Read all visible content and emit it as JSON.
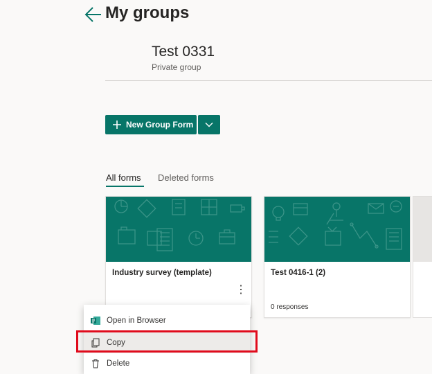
{
  "header": {
    "title": "My groups"
  },
  "group": {
    "name": "Test 0331",
    "type": "Private group"
  },
  "actions": {
    "new_group_form_label": "New Group Form"
  },
  "tabs": [
    {
      "label": "All forms",
      "selected": true
    },
    {
      "label": "Deleted forms",
      "selected": false
    }
  ],
  "cards": [
    {
      "title": "Industry survey (template)",
      "responses": ""
    },
    {
      "title": "Test 0416-1 (2)",
      "responses": "0 responses"
    }
  ],
  "context_menu": {
    "items": [
      {
        "label": "Open in Browser",
        "icon": "forms-icon"
      },
      {
        "label": "Copy",
        "icon": "copy-icon"
      },
      {
        "label": "Delete",
        "icon": "trash-icon"
      }
    ]
  },
  "colors": {
    "accent": "#077568",
    "highlight": "#e00b1c"
  }
}
